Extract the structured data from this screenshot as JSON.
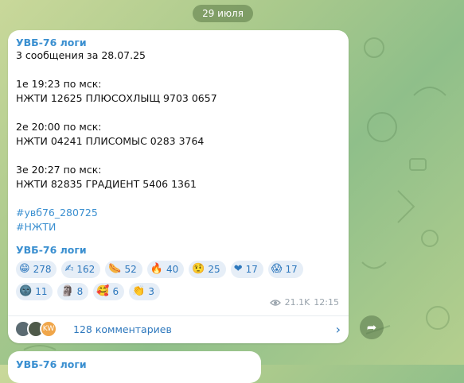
{
  "date_label": "29 июля",
  "post": {
    "sender": "УВБ-76 логи",
    "lines": [
      "3 сообщения за 28.07.25",
      "",
      "1е 19:23 по мск:",
      "НЖТИ 12625 ПЛЮСОХЛЫЩ 9703 0657",
      "",
      "2е 20:00 по мск:",
      "НЖТИ 04241 ПЛИСОМЫС 0283 3764",
      "",
      "3е 20:27 по мск:",
      "НЖТИ 82835 ГРАДИЕНТ 5406 1361",
      ""
    ],
    "hashtags": [
      "#увб76_280725",
      "#НЖТИ"
    ],
    "signature": "УВБ-76 логи",
    "reactions": [
      {
        "emoji": "😁",
        "count": "278"
      },
      {
        "emoji": "✍",
        "count": "162"
      },
      {
        "emoji": "🌭",
        "count": "52"
      },
      {
        "emoji": "🔥",
        "count": "40"
      },
      {
        "emoji": "🤨",
        "count": "25"
      },
      {
        "emoji": "❤",
        "count": "17"
      },
      {
        "emoji": "😱",
        "count": "17"
      },
      {
        "emoji": "🌚",
        "count": "11"
      },
      {
        "emoji": "🗿",
        "count": "8"
      },
      {
        "emoji": "🥰",
        "count": "6"
      },
      {
        "emoji": "👏",
        "count": "3"
      }
    ],
    "views": "21.1K",
    "time": "12:15",
    "comments_label": "128 комментариев",
    "avatar_initials": "KW"
  },
  "next_post_sender": "УВБ-76 логи",
  "icons": {
    "views": "eye-icon",
    "chevron": "chevron-right-icon",
    "share": "share-icon"
  }
}
